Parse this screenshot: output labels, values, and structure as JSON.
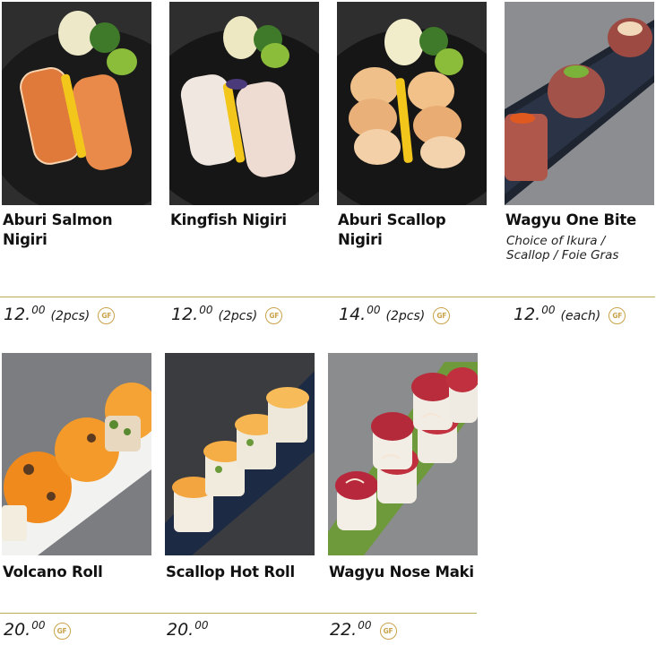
{
  "items": [
    {
      "name": "Aburi Salmon\nNigiri",
      "desc": "",
      "price_whole": "12.",
      "price_cents": "00",
      "unit": "(2pcs)",
      "gf": "GF"
    },
    {
      "name": "Kingfish Nigiri",
      "desc": "",
      "price_whole": "12.",
      "price_cents": "00",
      "unit": "(2pcs)",
      "gf": "GF"
    },
    {
      "name": "Aburi Scallop\nNigiri",
      "desc": "",
      "price_whole": "14.",
      "price_cents": "00",
      "unit": "(2pcs)",
      "gf": "GF"
    },
    {
      "name": "Wagyu One Bite",
      "desc": "Choice of Ikura /\nScallop / Foie Gras",
      "price_whole": "12.",
      "price_cents": "00",
      "unit": "(each)",
      "gf": "GF"
    },
    {
      "name": "Volcano Roll",
      "desc": "",
      "price_whole": "20.",
      "price_cents": "00",
      "unit": "",
      "gf": "GF"
    },
    {
      "name": "Scallop Hot Roll",
      "desc": "",
      "price_whole": "20.",
      "price_cents": "00",
      "unit": "",
      "gf": ""
    },
    {
      "name": "Wagyu Nose Maki",
      "desc": "",
      "price_whole": "22.",
      "price_cents": "00",
      "unit": "",
      "gf": "GF"
    }
  ],
  "colors": {
    "rule": "#b9ad58",
    "gf_badge": "#c9a24a"
  }
}
